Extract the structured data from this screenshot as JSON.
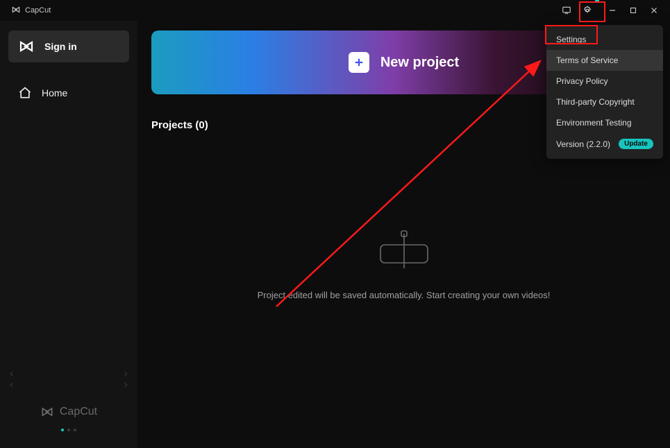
{
  "titlebar": {
    "brand": "CapCut"
  },
  "sidebar": {
    "signin_label": "Sign in",
    "home_label": "Home",
    "footer_brand": "CapCut"
  },
  "main": {
    "new_project_label": "New project",
    "projects_header": "Projects  (0)",
    "empty_message": "Project edited will be saved automatically. Start creating your own videos!"
  },
  "settings_menu": {
    "items": [
      {
        "label": "Settings"
      },
      {
        "label": "Terms of Service"
      },
      {
        "label": "Privacy Policy"
      },
      {
        "label": "Third-party Copyright"
      },
      {
        "label": "Environment Testing"
      },
      {
        "label": "Version (2.2.0)",
        "badge": "Update"
      }
    ]
  }
}
